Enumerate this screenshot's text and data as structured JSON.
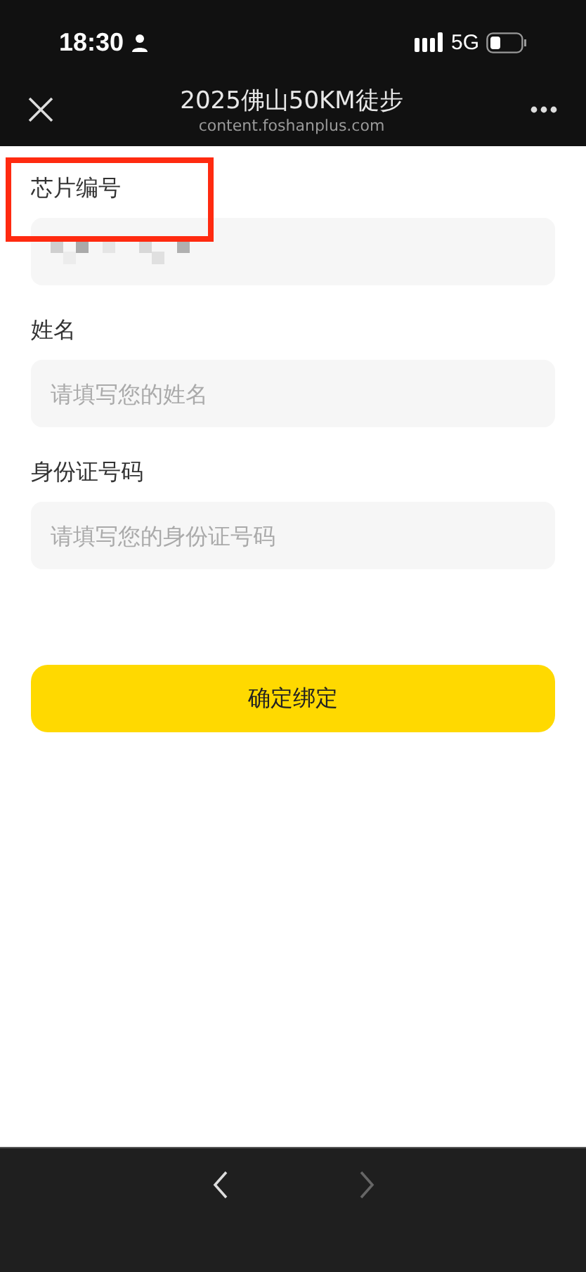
{
  "status_bar": {
    "time": "18:30",
    "network": "5G"
  },
  "header": {
    "title": "2025佛山50KM徒步",
    "subtitle": "content.foshanplus.com"
  },
  "fields": [
    {
      "label": "芯片编号",
      "kind": "redacted",
      "highlighted": true
    },
    {
      "label": "姓名",
      "kind": "text",
      "placeholder": "请填写您的姓名",
      "highlighted": false
    },
    {
      "label": "身份证号码",
      "kind": "text",
      "placeholder": "请填写您的身份证号码",
      "highlighted": false
    }
  ],
  "submit_button": "确定绑定",
  "bottom_nav": {
    "back": {
      "disabled": false
    },
    "forward": {
      "disabled": true
    }
  }
}
